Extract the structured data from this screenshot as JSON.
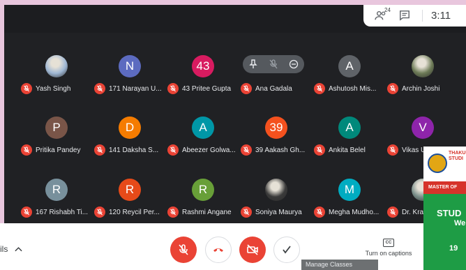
{
  "header": {
    "participants_count": "24",
    "clock": "3:11"
  },
  "participants": [
    {
      "name": "Yash Singh",
      "avatar_letter": "",
      "avatar_color": "#9fb7d4",
      "photo": true
    },
    {
      "name": "171 Narayan U...",
      "avatar_letter": "N",
      "avatar_color": "#5c6bc0",
      "photo": false
    },
    {
      "name": "43 Pritee Gupta",
      "avatar_letter": "43",
      "avatar_color": "#d81b60",
      "photo": false
    },
    {
      "name": "Ana Gadala",
      "avatar_letter": "",
      "avatar_color": "#c0612d",
      "photo": false
    },
    {
      "name": "Ashutosh Mis...",
      "avatar_letter": "A",
      "avatar_color": "#5f6368",
      "photo": false
    },
    {
      "name": "Archin Joshi",
      "avatar_letter": "",
      "avatar_color": "#6d7b57",
      "photo": true
    },
    {
      "name": "Pritika Pandey",
      "avatar_letter": "P",
      "avatar_color": "#795548",
      "photo": false
    },
    {
      "name": "141 Daksha S...",
      "avatar_letter": "D",
      "avatar_color": "#f57c00",
      "photo": false
    },
    {
      "name": "Abeezer Golwa...",
      "avatar_letter": "A",
      "avatar_color": "#0097a7",
      "photo": false
    },
    {
      "name": "39 Aakash Gh...",
      "avatar_letter": "39",
      "avatar_color": "#f4511e",
      "photo": false
    },
    {
      "name": "Ankita Belel",
      "avatar_letter": "A",
      "avatar_color": "#00897b",
      "photo": false
    },
    {
      "name": "Vikas U...",
      "avatar_letter": "V",
      "avatar_color": "#8e24aa",
      "photo": false
    },
    {
      "name": "167 Rishabh Ti...",
      "avatar_letter": "R",
      "avatar_color": "#78909c",
      "photo": false
    },
    {
      "name": "120 Reycil Per...",
      "avatar_letter": "R",
      "avatar_color": "#e64a19",
      "photo": false
    },
    {
      "name": "Rashmi Angane",
      "avatar_letter": "R",
      "avatar_color": "#689f38",
      "photo": false
    },
    {
      "name": "Soniya Maurya",
      "avatar_letter": "",
      "avatar_color": "#3a3a3a",
      "photo": true
    },
    {
      "name": "Megha Mudho...",
      "avatar_letter": "M",
      "avatar_color": "#00acc1",
      "photo": false
    },
    {
      "name": "Dr. Kra...",
      "avatar_letter": "",
      "avatar_color": "#7a8f8a",
      "photo": true
    }
  ],
  "bottom_bar": {
    "details_label": "ils",
    "captions_label": "Turn on captions",
    "captions_icon_text": "CC",
    "manage_label": "Manage Classes"
  },
  "poster": {
    "org_line1": "THAKU",
    "org_line2": "STUDI",
    "red_band": "MASTER OF",
    "big_text": "STUD",
    "sub_text": "We",
    "number": "19"
  },
  "colors": {
    "muted": "#ea4335",
    "stage": "#202124"
  }
}
